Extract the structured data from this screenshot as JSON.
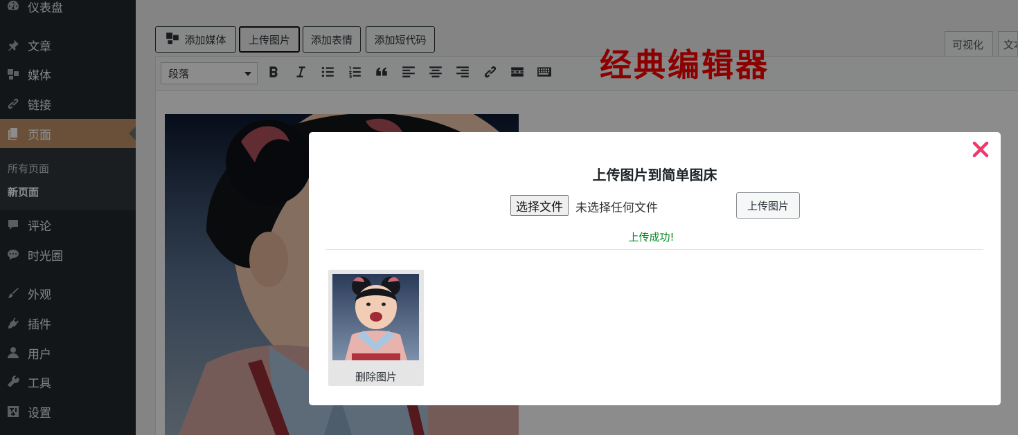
{
  "sidebar": {
    "items": [
      {
        "label": "仪表盘",
        "icon": "dashboard-icon"
      },
      {
        "label": "文章",
        "icon": "pin-icon"
      },
      {
        "label": "媒体",
        "icon": "media-icon"
      },
      {
        "label": "链接",
        "icon": "link-icon"
      },
      {
        "label": "页面",
        "icon": "pages-icon"
      },
      {
        "label": "评论",
        "icon": "comment-icon"
      },
      {
        "label": "时光圈",
        "icon": "chat-bubbles-icon"
      },
      {
        "label": "外观",
        "icon": "brush-icon"
      },
      {
        "label": "插件",
        "icon": "plugin-icon"
      },
      {
        "label": "用户",
        "icon": "user-icon"
      },
      {
        "label": "工具",
        "icon": "wrench-icon"
      },
      {
        "label": "设置",
        "icon": "settings-icon"
      }
    ],
    "submenu": [
      {
        "label": "所有页面"
      },
      {
        "label": "新页面"
      }
    ]
  },
  "editor": {
    "media_buttons": [
      {
        "label": "添加媒体"
      },
      {
        "label": "上传图片"
      },
      {
        "label": "添加表情"
      },
      {
        "label": "添加短代码"
      }
    ],
    "tabs": [
      {
        "label": "可视化"
      },
      {
        "label": "文本"
      }
    ],
    "format_select": "段落",
    "toolbar_icons": [
      "bold-icon",
      "italic-icon",
      "bullet-list-icon",
      "numbered-list-icon",
      "blockquote-icon",
      "align-left-icon",
      "align-center-icon",
      "align-right-icon",
      "link-icon",
      "read-more-icon",
      "toolbar-toggle-icon"
    ],
    "watermark": "经典编辑器"
  },
  "modal": {
    "title": "上传图片到简单图床",
    "file_button": "选择文件",
    "file_status": "未选择任何文件",
    "upload_button": "上传图片",
    "success": "上传成功!",
    "delete_button": "删除图片"
  },
  "colors": {
    "sidebar_bg": "#23282d",
    "active_menu": "#c19366",
    "success_text": "#008a20",
    "close_icon": "#f0386b",
    "watermark": "#ff0000"
  }
}
